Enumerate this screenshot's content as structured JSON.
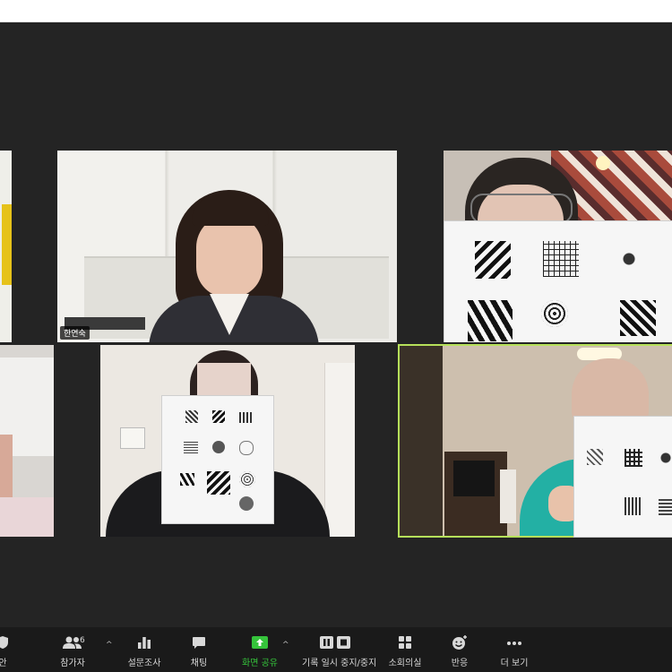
{
  "participants": {
    "host": {
      "name": "한연숙"
    },
    "top_right": {
      "name": ""
    },
    "bottom_middle": {
      "name": ""
    },
    "bottom_right": {
      "name": ""
    }
  },
  "toolbar": {
    "security": {
      "label": "안",
      "icon": "shield-icon"
    },
    "participants": {
      "label": "참가자",
      "count": "6",
      "icon": "participants-icon"
    },
    "polls": {
      "label": "설문조사",
      "icon": "bar-chart-icon"
    },
    "chat": {
      "label": "채팅",
      "icon": "chat-icon"
    },
    "share_screen": {
      "label": "화면 공유",
      "icon": "share-screen-icon",
      "color": "#35c33b"
    },
    "record": {
      "label": "기록 일시 중지/중지",
      "icon": "pause-stop-icon"
    },
    "breakout": {
      "label": "소회의실",
      "icon": "grid-icon"
    },
    "reactions": {
      "label": "반응",
      "icon": "emoji-icon"
    },
    "more": {
      "label": "더 보기",
      "icon": "ellipsis-icon"
    }
  },
  "colors": {
    "active_speaker_border": "#b6e05a",
    "background": "#242424",
    "toolbar": "#1a1a1a"
  }
}
